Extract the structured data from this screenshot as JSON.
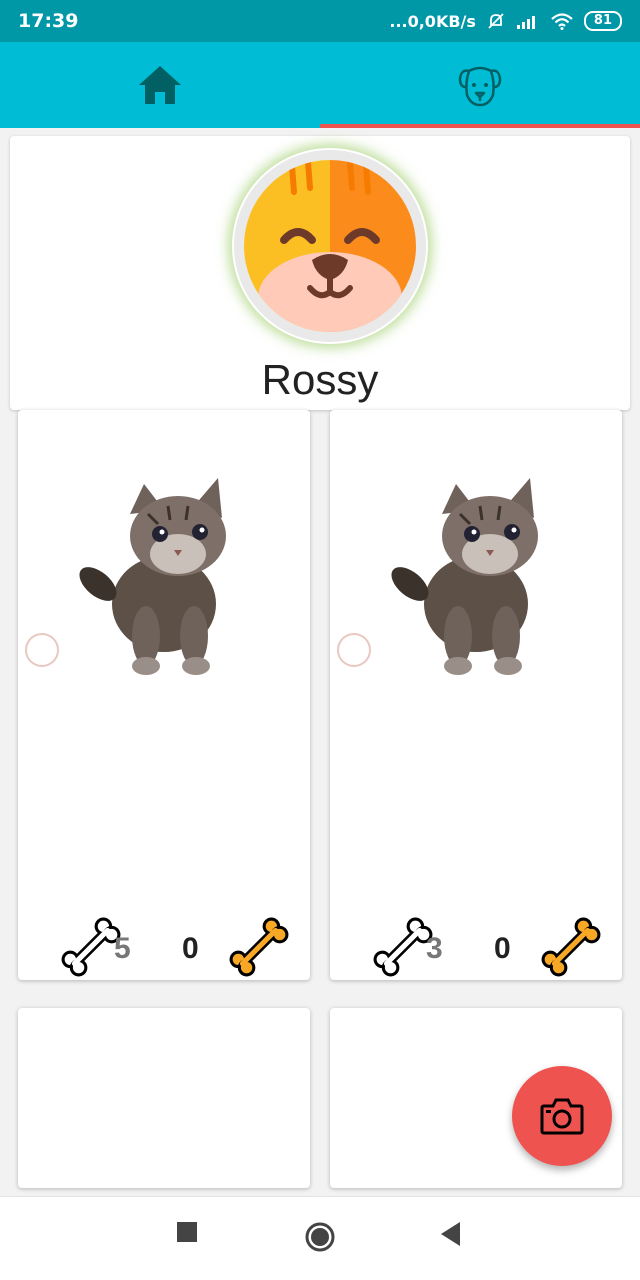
{
  "status_bar": {
    "time": "17:39",
    "network_speed": "...0,0KB/s",
    "battery": "81",
    "icons": [
      "bell-off-icon",
      "signal-icon",
      "wifi-icon",
      "battery-icon"
    ]
  },
  "tabs": [
    {
      "name": "home",
      "icon": "home-icon",
      "active": false
    },
    {
      "name": "pet",
      "icon": "dog-face-icon",
      "active": true
    }
  ],
  "profile": {
    "name": "Rossy",
    "avatar_icon": "cat-face-icon"
  },
  "posts": [
    {
      "image": "kitten-photo",
      "likes": "5",
      "treats": "0",
      "like_icon": "bone-outline-icon",
      "treat_icon": "bone-filled-icon"
    },
    {
      "image": "kitten-photo",
      "likes": "3",
      "treats": "0",
      "like_icon": "bone-outline-icon",
      "treat_icon": "bone-filled-icon"
    }
  ],
  "fab": {
    "icon": "camera-icon"
  },
  "colors": {
    "status_bar": "#0097a7",
    "tab_bar": "#00bcd4",
    "tab_indicator": "#ef5350",
    "fab": "#ef5350",
    "avatar_glow": "#8bc34a",
    "bone_filled": "#f9a825"
  },
  "nav_bar": {
    "buttons": [
      "recents-square-icon",
      "home-circle-icon",
      "back-triangle-icon"
    ]
  }
}
